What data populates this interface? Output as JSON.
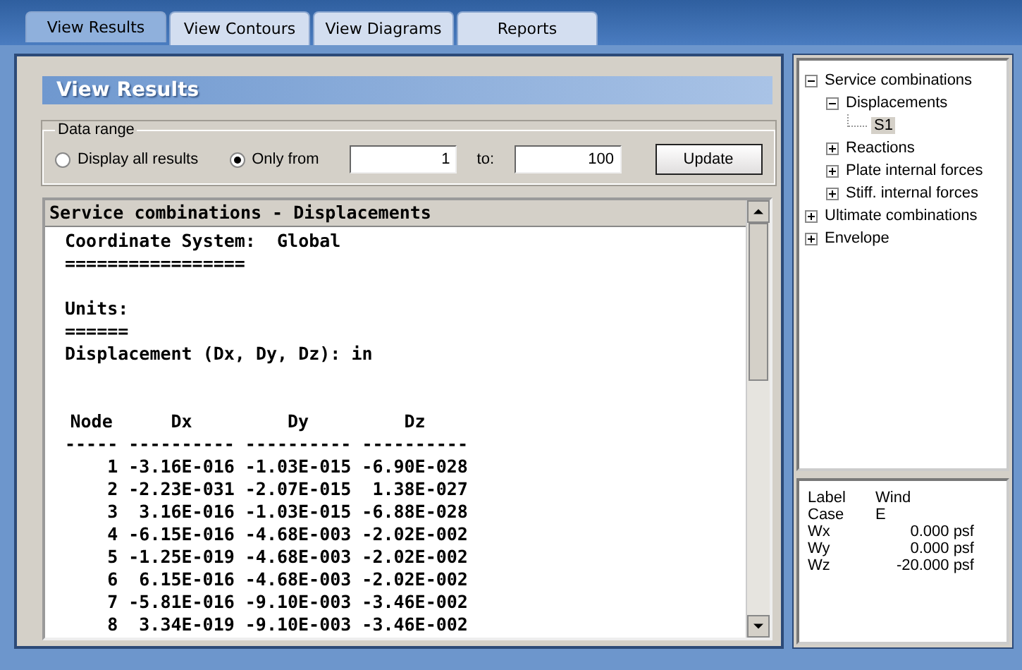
{
  "tabs": [
    {
      "label": "View Results",
      "selected": true
    },
    {
      "label": "View Contours",
      "selected": false
    },
    {
      "label": "View Diagrams",
      "selected": false
    },
    {
      "label": "Reports",
      "selected": false
    }
  ],
  "panel": {
    "title": "View Results",
    "data_range": {
      "legend": "Data range",
      "options": [
        {
          "label": "Display all results",
          "selected": false
        },
        {
          "label": "Only from",
          "selected": true
        }
      ],
      "from": "1",
      "to_label": "to:",
      "to": "100",
      "button": "Update"
    },
    "report": {
      "title": "Service combinations - Displacements",
      "sections": [
        {
          "lines": [
            "Coordinate System:  Global",
            "================="
          ]
        },
        {
          "lines": [
            "Units:",
            "======",
            "Displacement (Dx, Dy, Dz): in"
          ]
        }
      ],
      "table": {
        "columns": [
          "Node",
          "Dx",
          "Dy",
          "Dz"
        ],
        "rule": "----- ---------- ---------- ----------",
        "rows": [
          [
            "1",
            "-3.16E-016",
            "-1.03E-015",
            "-6.90E-028"
          ],
          [
            "2",
            "-2.23E-031",
            "-2.07E-015",
            "1.38E-027"
          ],
          [
            "3",
            "3.16E-016",
            "-1.03E-015",
            "-6.88E-028"
          ],
          [
            "4",
            "-6.15E-016",
            "-4.68E-003",
            "-2.02E-002"
          ],
          [
            "5",
            "-1.25E-019",
            "-4.68E-003",
            "-2.02E-002"
          ],
          [
            "6",
            "6.15E-016",
            "-4.68E-003",
            "-2.02E-002"
          ],
          [
            "7",
            "-5.81E-016",
            "-9.10E-003",
            "-3.46E-002"
          ],
          [
            "8",
            "3.34E-019",
            "-9.10E-003",
            "-3.46E-002"
          ]
        ]
      }
    }
  },
  "tree": [
    {
      "label": "Service combinations",
      "expanded": true,
      "selected": false,
      "children": [
        {
          "label": "Displacements",
          "expanded": true,
          "selected": false,
          "children": [
            {
              "label": "S1",
              "selected": true
            }
          ]
        },
        {
          "label": "Reactions",
          "expanded": false,
          "selected": false
        },
        {
          "label": "Plate internal forces",
          "expanded": false,
          "selected": false
        },
        {
          "label": "Stiff. internal forces",
          "expanded": false,
          "selected": false
        }
      ]
    },
    {
      "label": "Ultimate combinations",
      "expanded": false,
      "selected": false
    },
    {
      "label": "Envelope",
      "expanded": false,
      "selected": false
    }
  ],
  "properties": [
    {
      "label": "Label",
      "value": "Wind"
    },
    {
      "label": "Case",
      "value": "E"
    },
    {
      "label": "Wx",
      "value": "0.000 psf"
    },
    {
      "label": "Wy",
      "value": "0.000 psf"
    },
    {
      "label": "Wz",
      "value": "-20.000 psf"
    }
  ]
}
